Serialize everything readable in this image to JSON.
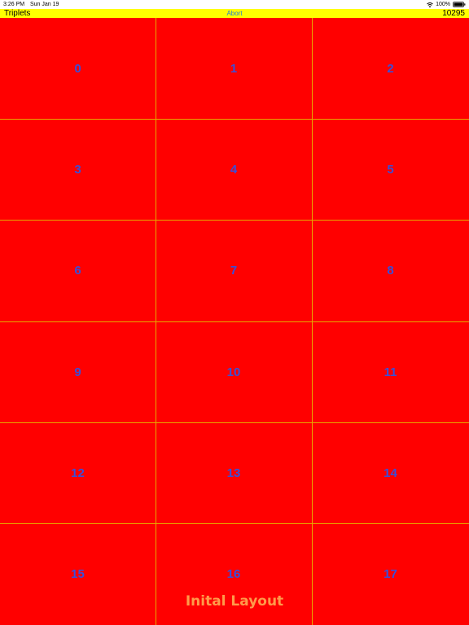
{
  "status_bar": {
    "time": "3:26 PM",
    "date": "Sun Jan 19",
    "battery": "100%",
    "icons": [
      "wifi-icon",
      "battery-icon"
    ]
  },
  "title_bar": {
    "title": "Triplets",
    "abort_label": "Abort",
    "score": "10295",
    "background_color": "#ffff00",
    "abort_color": "#1e7fd6"
  },
  "grid": {
    "columns": 3,
    "rows": 6,
    "cell_color": "#ff0000",
    "line_color": "#e6a800",
    "label_color": "#3a4fd8",
    "cells": [
      "0",
      "1",
      "2",
      "3",
      "4",
      "5",
      "6",
      "7",
      "8",
      "9",
      "10",
      "11",
      "12",
      "13",
      "14",
      "15",
      "16",
      "17"
    ]
  },
  "footer": {
    "label": "Inital Layout",
    "color": "#ff9a4a"
  }
}
